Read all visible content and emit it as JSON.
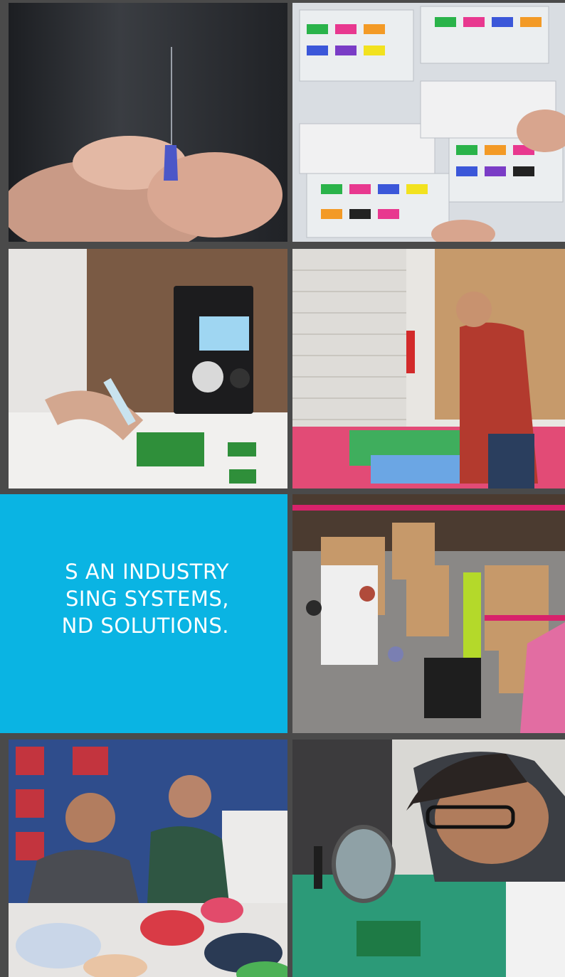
{
  "headline": {
    "line1": "S AN INDUSTRY",
    "line2": "SING SYSTEMS,",
    "line3": "ND SOLUTIONS."
  },
  "colors": {
    "accent": "#0ab4e3",
    "background": "#4a4a4a"
  }
}
